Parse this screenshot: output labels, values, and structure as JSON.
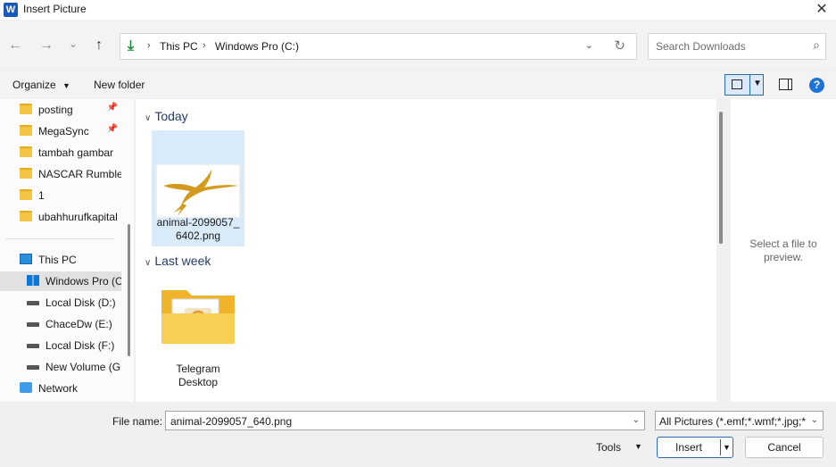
{
  "window": {
    "title": "Insert Picture",
    "app_icon": "W",
    "close_glyph": "✕"
  },
  "nav": {
    "back_glyph": "←",
    "forward_glyph": "→",
    "recent_glyph": "⌄",
    "up_glyph": "↑",
    "breadcrumb": [
      "This PC",
      "Windows Pro  (C:)"
    ],
    "search_placeholder": "Search Downloads"
  },
  "toolbar": {
    "organize": "Organize",
    "new_folder": "New folder",
    "help": "?"
  },
  "sidebar": {
    "quick_access": [
      {
        "label": "posting",
        "pinned": true
      },
      {
        "label": "MegaSync",
        "pinned": true
      },
      {
        "label": "tambah gambar",
        "pinned": false
      },
      {
        "label": "NASCAR Rumble",
        "pinned": false
      },
      {
        "label": "1",
        "pinned": false
      },
      {
        "label": "ubahhurufkapital",
        "pinned": false
      }
    ],
    "this_pc": "This PC",
    "drives": [
      {
        "label": "Windows Pro  (C",
        "selected": true
      },
      {
        "label": "Local Disk (D:)",
        "selected": false
      },
      {
        "label": "ChaceDw (E:)",
        "selected": false
      },
      {
        "label": "Local Disk (F:)",
        "selected": false
      },
      {
        "label": "New Volume (G:",
        "selected": false
      }
    ],
    "network": "Network"
  },
  "main": {
    "groups": [
      {
        "label": "Today",
        "items": [
          {
            "name_line1": "animal-2099057_",
            "name_line2": "6402.png",
            "selected": true
          }
        ]
      },
      {
        "label": "Last week",
        "items": [
          {
            "name_line1": "Telegram",
            "name_line2": "Desktop",
            "selected": false
          }
        ]
      }
    ]
  },
  "preview": {
    "line1": "Select a file to",
    "line2": "preview."
  },
  "bottom": {
    "file_name_label": "File name:",
    "file_name_value": "animal-2099057_640.png",
    "file_type": "All Pictures (*.emf;*.wmf;*.jpg;*",
    "tools": "Tools",
    "insert": "Insert",
    "cancel": "Cancel"
  }
}
